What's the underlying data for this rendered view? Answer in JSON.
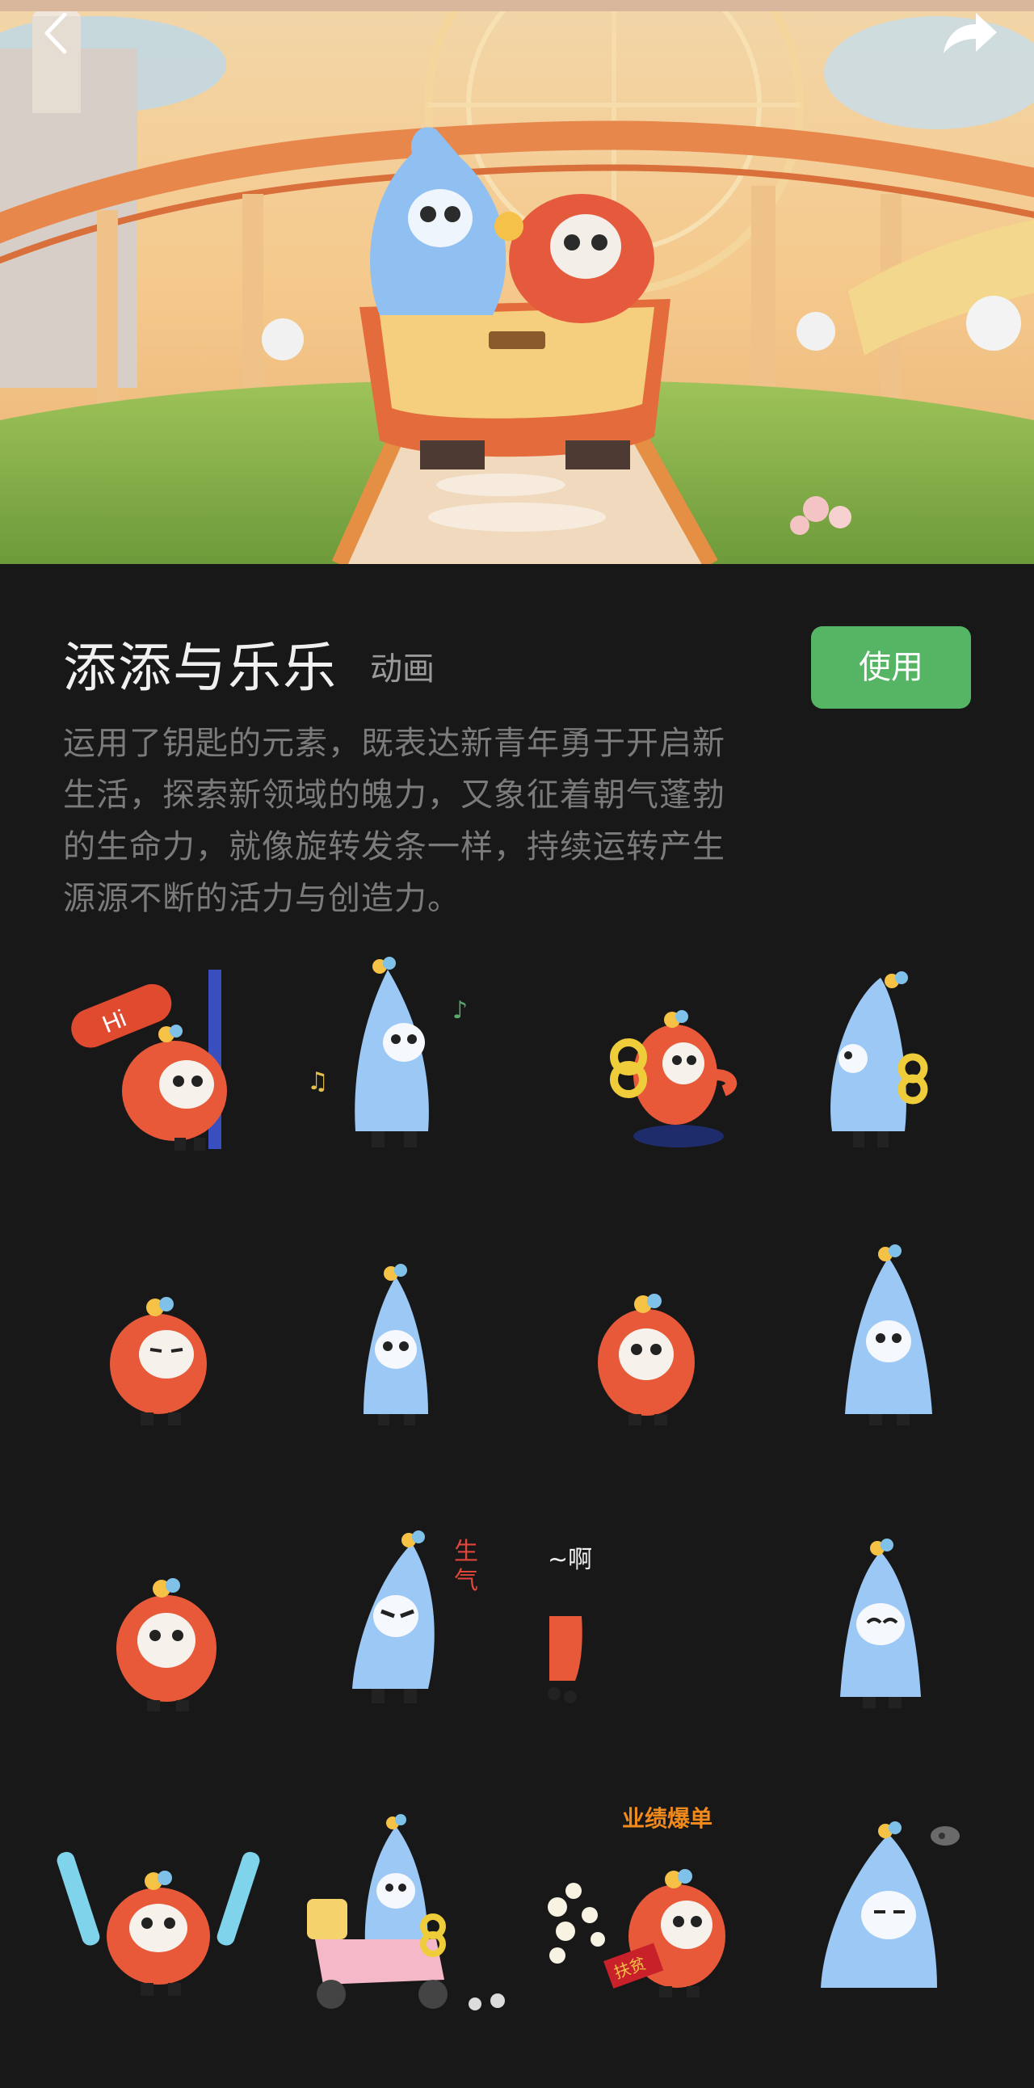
{
  "pack": {
    "title": "添添与乐乐",
    "tag": "动画",
    "use_label": "使用",
    "description": "运用了钥匙的元素，既表达新青年勇于开启新生活，探索新领域的魄力，又象征着朝气蓬勃的生命力，就像旋转发条一样，持续运转产生源源不断的活力与创造力。"
  },
  "nav": {
    "back_icon": "back-chevron-icon",
    "share_icon": "share-arrow-icon"
  },
  "banner": {
    "icon": "roller-coaster-illustration"
  },
  "colors": {
    "background": "#181818",
    "use_button": "#55b564",
    "blue_character": "#9cc8f5",
    "red_character": "#e8593a"
  },
  "sticker_texts": {
    "hi": "Hi",
    "shengqi_1": "生",
    "shengqi_2": "气",
    "a": "~啊",
    "yeji": "业绩爆单",
    "envelope": "扶贫"
  },
  "stickers": [
    {
      "name": "sticker-red-hi-peek"
    },
    {
      "name": "sticker-blue-music"
    },
    {
      "name": "sticker-red-windup-key"
    },
    {
      "name": "sticker-blue-windup-back"
    },
    {
      "name": "sticker-red-squint"
    },
    {
      "name": "sticker-blue-standing"
    },
    {
      "name": "sticker-red-standing"
    },
    {
      "name": "sticker-blue-tall"
    },
    {
      "name": "sticker-red-plain"
    },
    {
      "name": "sticker-blue-angry"
    },
    {
      "name": "sticker-red-shout"
    },
    {
      "name": "sticker-blue-smile"
    },
    {
      "name": "sticker-red-cheer"
    },
    {
      "name": "sticker-blue-scooter"
    },
    {
      "name": "sticker-red-sales-boom"
    },
    {
      "name": "sticker-blue-sigh"
    }
  ]
}
